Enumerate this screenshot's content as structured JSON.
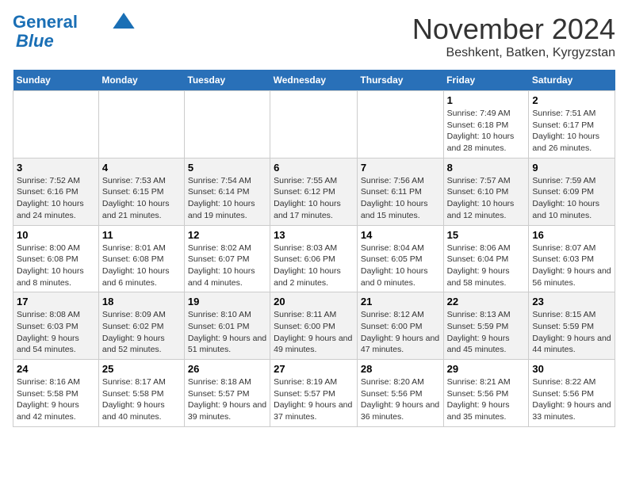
{
  "header": {
    "logo_line1": "General",
    "logo_line2": "Blue",
    "month": "November 2024",
    "location": "Beshkent, Batken, Kyrgyzstan"
  },
  "days_of_week": [
    "Sunday",
    "Monday",
    "Tuesday",
    "Wednesday",
    "Thursday",
    "Friday",
    "Saturday"
  ],
  "weeks": [
    [
      {
        "day": "",
        "sunrise": "",
        "sunset": "",
        "daylight": ""
      },
      {
        "day": "",
        "sunrise": "",
        "sunset": "",
        "daylight": ""
      },
      {
        "day": "",
        "sunrise": "",
        "sunset": "",
        "daylight": ""
      },
      {
        "day": "",
        "sunrise": "",
        "sunset": "",
        "daylight": ""
      },
      {
        "day": "",
        "sunrise": "",
        "sunset": "",
        "daylight": ""
      },
      {
        "day": "1",
        "sunrise": "Sunrise: 7:49 AM",
        "sunset": "Sunset: 6:18 PM",
        "daylight": "Daylight: 10 hours and 28 minutes."
      },
      {
        "day": "2",
        "sunrise": "Sunrise: 7:51 AM",
        "sunset": "Sunset: 6:17 PM",
        "daylight": "Daylight: 10 hours and 26 minutes."
      }
    ],
    [
      {
        "day": "3",
        "sunrise": "Sunrise: 7:52 AM",
        "sunset": "Sunset: 6:16 PM",
        "daylight": "Daylight: 10 hours and 24 minutes."
      },
      {
        "day": "4",
        "sunrise": "Sunrise: 7:53 AM",
        "sunset": "Sunset: 6:15 PM",
        "daylight": "Daylight: 10 hours and 21 minutes."
      },
      {
        "day": "5",
        "sunrise": "Sunrise: 7:54 AM",
        "sunset": "Sunset: 6:14 PM",
        "daylight": "Daylight: 10 hours and 19 minutes."
      },
      {
        "day": "6",
        "sunrise": "Sunrise: 7:55 AM",
        "sunset": "Sunset: 6:12 PM",
        "daylight": "Daylight: 10 hours and 17 minutes."
      },
      {
        "day": "7",
        "sunrise": "Sunrise: 7:56 AM",
        "sunset": "Sunset: 6:11 PM",
        "daylight": "Daylight: 10 hours and 15 minutes."
      },
      {
        "day": "8",
        "sunrise": "Sunrise: 7:57 AM",
        "sunset": "Sunset: 6:10 PM",
        "daylight": "Daylight: 10 hours and 12 minutes."
      },
      {
        "day": "9",
        "sunrise": "Sunrise: 7:59 AM",
        "sunset": "Sunset: 6:09 PM",
        "daylight": "Daylight: 10 hours and 10 minutes."
      }
    ],
    [
      {
        "day": "10",
        "sunrise": "Sunrise: 8:00 AM",
        "sunset": "Sunset: 6:08 PM",
        "daylight": "Daylight: 10 hours and 8 minutes."
      },
      {
        "day": "11",
        "sunrise": "Sunrise: 8:01 AM",
        "sunset": "Sunset: 6:08 PM",
        "daylight": "Daylight: 10 hours and 6 minutes."
      },
      {
        "day": "12",
        "sunrise": "Sunrise: 8:02 AM",
        "sunset": "Sunset: 6:07 PM",
        "daylight": "Daylight: 10 hours and 4 minutes."
      },
      {
        "day": "13",
        "sunrise": "Sunrise: 8:03 AM",
        "sunset": "Sunset: 6:06 PM",
        "daylight": "Daylight: 10 hours and 2 minutes."
      },
      {
        "day": "14",
        "sunrise": "Sunrise: 8:04 AM",
        "sunset": "Sunset: 6:05 PM",
        "daylight": "Daylight: 10 hours and 0 minutes."
      },
      {
        "day": "15",
        "sunrise": "Sunrise: 8:06 AM",
        "sunset": "Sunset: 6:04 PM",
        "daylight": "Daylight: 9 hours and 58 minutes."
      },
      {
        "day": "16",
        "sunrise": "Sunrise: 8:07 AM",
        "sunset": "Sunset: 6:03 PM",
        "daylight": "Daylight: 9 hours and 56 minutes."
      }
    ],
    [
      {
        "day": "17",
        "sunrise": "Sunrise: 8:08 AM",
        "sunset": "Sunset: 6:03 PM",
        "daylight": "Daylight: 9 hours and 54 minutes."
      },
      {
        "day": "18",
        "sunrise": "Sunrise: 8:09 AM",
        "sunset": "Sunset: 6:02 PM",
        "daylight": "Daylight: 9 hours and 52 minutes."
      },
      {
        "day": "19",
        "sunrise": "Sunrise: 8:10 AM",
        "sunset": "Sunset: 6:01 PM",
        "daylight": "Daylight: 9 hours and 51 minutes."
      },
      {
        "day": "20",
        "sunrise": "Sunrise: 8:11 AM",
        "sunset": "Sunset: 6:00 PM",
        "daylight": "Daylight: 9 hours and 49 minutes."
      },
      {
        "day": "21",
        "sunrise": "Sunrise: 8:12 AM",
        "sunset": "Sunset: 6:00 PM",
        "daylight": "Daylight: 9 hours and 47 minutes."
      },
      {
        "day": "22",
        "sunrise": "Sunrise: 8:13 AM",
        "sunset": "Sunset: 5:59 PM",
        "daylight": "Daylight: 9 hours and 45 minutes."
      },
      {
        "day": "23",
        "sunrise": "Sunrise: 8:15 AM",
        "sunset": "Sunset: 5:59 PM",
        "daylight": "Daylight: 9 hours and 44 minutes."
      }
    ],
    [
      {
        "day": "24",
        "sunrise": "Sunrise: 8:16 AM",
        "sunset": "Sunset: 5:58 PM",
        "daylight": "Daylight: 9 hours and 42 minutes."
      },
      {
        "day": "25",
        "sunrise": "Sunrise: 8:17 AM",
        "sunset": "Sunset: 5:58 PM",
        "daylight": "Daylight: 9 hours and 40 minutes."
      },
      {
        "day": "26",
        "sunrise": "Sunrise: 8:18 AM",
        "sunset": "Sunset: 5:57 PM",
        "daylight": "Daylight: 9 hours and 39 minutes."
      },
      {
        "day": "27",
        "sunrise": "Sunrise: 8:19 AM",
        "sunset": "Sunset: 5:57 PM",
        "daylight": "Daylight: 9 hours and 37 minutes."
      },
      {
        "day": "28",
        "sunrise": "Sunrise: 8:20 AM",
        "sunset": "Sunset: 5:56 PM",
        "daylight": "Daylight: 9 hours and 36 minutes."
      },
      {
        "day": "29",
        "sunrise": "Sunrise: 8:21 AM",
        "sunset": "Sunset: 5:56 PM",
        "daylight": "Daylight: 9 hours and 35 minutes."
      },
      {
        "day": "30",
        "sunrise": "Sunrise: 8:22 AM",
        "sunset": "Sunset: 5:56 PM",
        "daylight": "Daylight: 9 hours and 33 minutes."
      }
    ]
  ]
}
